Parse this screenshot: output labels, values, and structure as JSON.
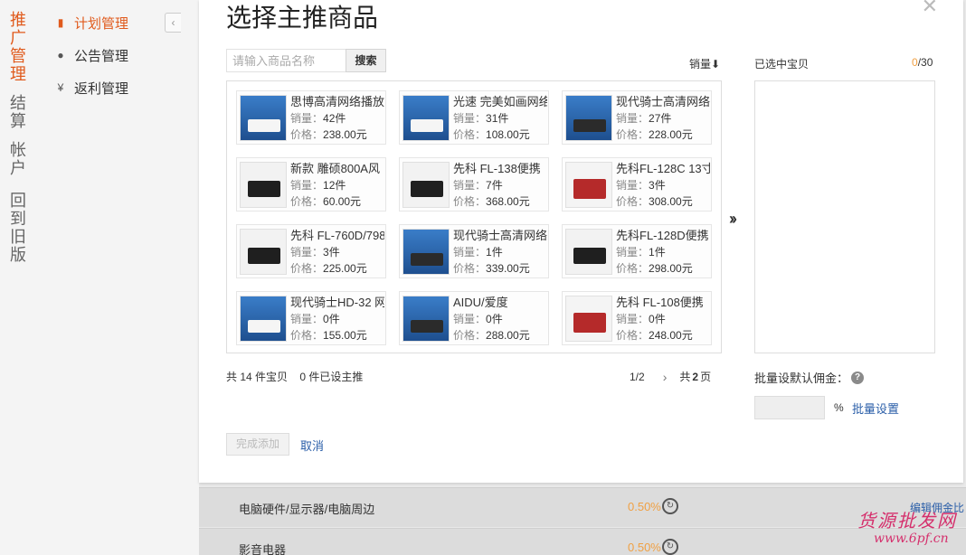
{
  "left_nav": [
    {
      "label": "推广管理",
      "active": true
    },
    {
      "label": "结算",
      "active": false
    },
    {
      "label": "帐户",
      "active": false
    },
    {
      "label": "回到旧版",
      "active": false
    }
  ],
  "sub_nav": [
    {
      "label": "计划管理",
      "icon": "clipboard-icon",
      "glyph": "▮",
      "active": true
    },
    {
      "label": "公告管理",
      "icon": "chat-icon",
      "glyph": "●",
      "active": false
    },
    {
      "label": "返利管理",
      "icon": "yen-icon",
      "glyph": "¥",
      "active": false
    }
  ],
  "collapse_glyph": "‹",
  "modal": {
    "title": "选择主推商品",
    "close_glyph": "✕",
    "search_placeholder": "请输入商品名称",
    "search_button": "搜索",
    "sort_label": "销量⬇",
    "sales_prefix": "销量：",
    "price_prefix": "价格：",
    "move_glyph": "››",
    "products": [
      {
        "name": "思博高清网络播放",
        "sales": "42件",
        "price": "238.00元",
        "thumb": "blue"
      },
      {
        "name": "光速 完美如画网络",
        "sales": "31件",
        "price": "108.00元",
        "thumb": "blue"
      },
      {
        "name": "现代骑士高清网络",
        "sales": "27件",
        "price": "228.00元",
        "thumb": "dark"
      },
      {
        "name": "新款 雕硕800A风",
        "sales": "12件",
        "price": "60.00元",
        "thumb": "white"
      },
      {
        "name": "先科 FL-138便携",
        "sales": "7件",
        "price": "368.00元",
        "thumb": "white"
      },
      {
        "name": "先科FL-128C 13寸",
        "sales": "3件",
        "price": "308.00元",
        "thumb": "red"
      },
      {
        "name": "先科 FL-760D/798",
        "sales": "3件",
        "price": "225.00元",
        "thumb": "white"
      },
      {
        "name": "现代骑士高清网络",
        "sales": "1件",
        "price": "339.00元",
        "thumb": "dark"
      },
      {
        "name": "先科FL-128D便携",
        "sales": "1件",
        "price": "298.00元",
        "thumb": "white"
      },
      {
        "name": "现代骑士HD-32 网",
        "sales": "0件",
        "price": "155.00元",
        "thumb": "blue"
      },
      {
        "name": "AIDU/爱度",
        "sales": "0件",
        "price": "288.00元",
        "thumb": "dark"
      },
      {
        "name": "先科 FL-108便携",
        "sales": "0件",
        "price": "248.00元",
        "thumb": "red"
      }
    ],
    "selected_label": "已选中宝贝",
    "selected_count": "0",
    "selected_max": "/30",
    "total_info": "共 14 件宝贝    0 件已设主推",
    "pager": {
      "current": "1/2",
      "next_glyph": "›",
      "total_prefix": "共",
      "total_pages": "2",
      "total_suffix": "页"
    },
    "batch_label": "批量设默认佣金：",
    "help_glyph": "?",
    "batch_unit": "%",
    "batch_link": "批量设置",
    "done_button": "完成添加",
    "cancel_link": "取消"
  },
  "background_rows": [
    {
      "category": "电脑硬件/显示器/电脑周边",
      "rate": "0.50%",
      "action": "编辑佣金比"
    },
    {
      "category": "影音电器",
      "rate": "0.50%",
      "action": ""
    }
  ],
  "watermark": {
    "text": "货源批发网",
    "url": "www.6pf.cn"
  }
}
